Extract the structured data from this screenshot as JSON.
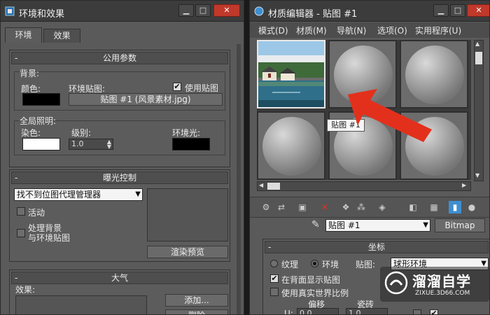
{
  "left_window": {
    "title": "环境和效果",
    "tabs": [
      "环境",
      "效果"
    ],
    "common_params": {
      "header": "公用参数",
      "background": {
        "group": "背景:",
        "color_label": "颜色:",
        "env_map_label": "环境贴图:",
        "use_map_label": "使用贴图",
        "use_map_checked": true,
        "map_button": "贴图 #1 (风景素材.jpg)"
      },
      "global_lighting": {
        "group": "全局照明:",
        "tint_label": "染色:",
        "level_label": "级别:",
        "level_value": "1.0",
        "ambient_label": "环境光:"
      }
    },
    "exposure": {
      "header": "曝光控制",
      "dropdown_value": "找不到位图代理管理器",
      "active_label": "活动",
      "process_bg_label_line1": "处理背景",
      "process_bg_label_line2": "与环境贴图",
      "render_preview": "渲染预览"
    },
    "atmosphere": {
      "header": "大气",
      "effects_label": "效果:",
      "add_button": "添加...",
      "delete_button": "删除"
    }
  },
  "right_window": {
    "title": "材质编辑器 - 贴图 #1",
    "menu": [
      "模式(D)",
      "材质(M)",
      "导航(N)",
      "选项(O)",
      "实用程序(U)"
    ],
    "tooltip": "贴图 #1",
    "map_name": "贴图 #1",
    "map_type": "Bitmap",
    "coords": {
      "header": "坐标",
      "texture_label": "纹理",
      "environ_label": "环境",
      "mapping_label": "贴图:",
      "mapping_value": "球形环境",
      "show_back_label": "在背面显示贴图",
      "real_world_label": "使用真实世界比例",
      "offset_label": "偏移",
      "tiling_label": "瓷砖",
      "u_label": "U:",
      "u_offset": "0.0",
      "u_tiling": "1.0"
    }
  },
  "watermark": {
    "brand": "溜溜自学",
    "url": "ZIXUE.3D66.COM"
  },
  "colors": {
    "accent_red": "#e3301c",
    "swatch_black": "#000000",
    "swatch_white": "#ffffff",
    "close_red": "#c0392b"
  }
}
